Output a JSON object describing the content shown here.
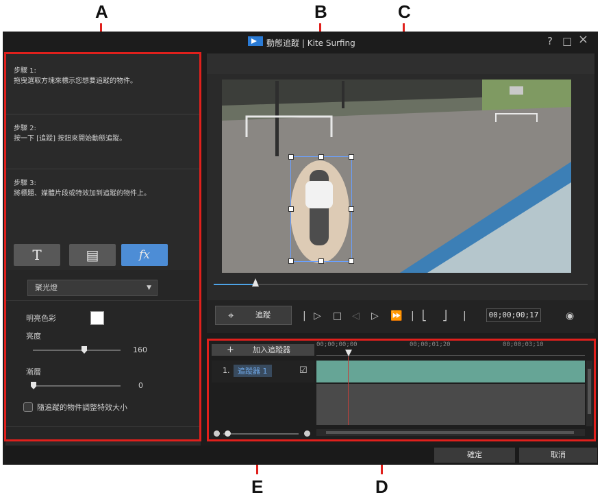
{
  "callouts": [
    "A",
    "B",
    "C",
    "D",
    "E"
  ],
  "window": {
    "title_app": "動態追蹤",
    "title_separator": "|",
    "title_project": "Kite Surfing",
    "help": "?",
    "maximize": "□",
    "close": "×"
  },
  "steps": [
    {
      "title": "步驟 1:",
      "text": "拖曳選取方塊來標示您想要追蹤的物件。"
    },
    {
      "title": "步驟 2:",
      "text": "按一下 [追蹤] 按鈕來開始動態追蹤。"
    },
    {
      "title": "步驟 3:",
      "text": "將標題、媒體片段或特效加到追蹤的物件上。"
    }
  ],
  "tabs": [
    {
      "label": "T",
      "icon": "title-icon"
    },
    {
      "label": "▤",
      "icon": "media-icon"
    },
    {
      "label": "fx",
      "icon": "fx-icon"
    }
  ],
  "effect": {
    "selected": "聚光燈",
    "highlight_color_label": "明亮色彩",
    "brightness_label": "亮度",
    "brightness_value": "160",
    "gradient_label": "漸層",
    "gradient_value": "0",
    "resize_label": "隨追蹤的物件調整特效大小"
  },
  "controls": {
    "track_label": "追蹤",
    "timecode": "00;00;00;17"
  },
  "timeline": {
    "add_tracker": "加入追蹤器",
    "ruler": [
      "00;00;00;00",
      "00;00;01;20",
      "00;00;03;10"
    ],
    "tracker_index": "1.",
    "tracker_name": "追蹤器 1"
  },
  "buttons": {
    "ok": "確定",
    "cancel": "取消"
  },
  "colors": {
    "highlight": "#e0201c",
    "accent": "#4d8dd6",
    "track_bar": "#66a596"
  }
}
